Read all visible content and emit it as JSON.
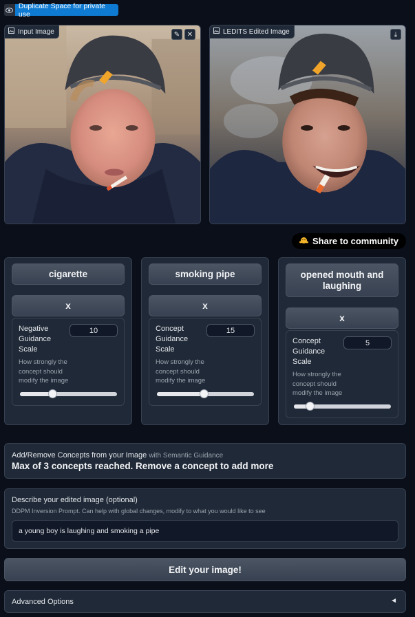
{
  "duplicate_badge": {
    "label": "Duplicate Space for private use"
  },
  "input_panel": {
    "label": "Input Image",
    "edit_icon": "pencil-icon",
    "clear_icon": "close-icon"
  },
  "output_panel": {
    "label": "LEDITS Edited Image",
    "download_icon": "download-icon"
  },
  "share": {
    "label": "Share to community",
    "icon": "hug-icon"
  },
  "concepts": [
    {
      "concept": "cigarette",
      "remove_label": "x",
      "scale_label": "Negative Guidance Scale",
      "value": "10",
      "info": "How strongly the concept should modify the image",
      "slider_fraction": 0.33
    },
    {
      "concept": "smoking pipe",
      "remove_label": "x",
      "scale_label": "Concept Guidance Scale",
      "value": "15",
      "info": "How strongly the concept should modify the image",
      "slider_fraction": 0.48
    },
    {
      "concept": "opened mouth and laughing",
      "remove_label": "x",
      "scale_label": "Concept Guidance Scale",
      "value": "5",
      "info": "How strongly the concept should modify the image",
      "slider_fraction": 0.16
    }
  ],
  "concepts_block": {
    "title": "Add/Remove Concepts from your Image",
    "subtitle": "with Semantic Guidance",
    "message": "Max of 3 concepts reached. Remove a concept to add more"
  },
  "prompt_block": {
    "title": "Describe your edited image (optional)",
    "info": "DDPM Inversion Prompt. Can help with global changes, modify to what you would like to see",
    "value": "a young boy is laughing and smoking a pipe"
  },
  "edit_button": {
    "label": "Edit your image!"
  },
  "advanced": {
    "label": "Advanced Options",
    "arrow": "◄"
  }
}
